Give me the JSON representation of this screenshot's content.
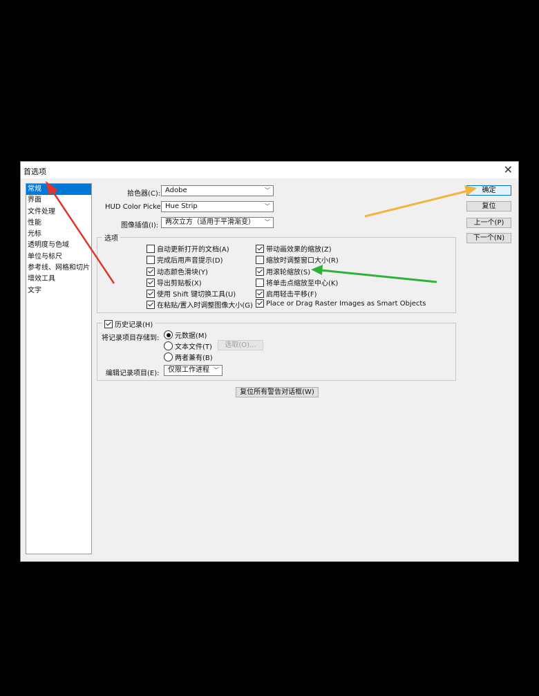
{
  "dialog": {
    "title": "首选项"
  },
  "sidebar": {
    "items": [
      {
        "label": "常规",
        "selected": true
      },
      {
        "label": "界面"
      },
      {
        "label": "文件处理"
      },
      {
        "label": "性能"
      },
      {
        "label": "光标"
      },
      {
        "label": "透明度与色域"
      },
      {
        "label": "单位与标尺"
      },
      {
        "label": "参考线、网格和切片"
      },
      {
        "label": "增效工具"
      },
      {
        "label": "文字"
      }
    ]
  },
  "fields": {
    "color_picker": {
      "label": "拾色器(C):",
      "value": "Adobe"
    },
    "hud_color_picker": {
      "label": "HUD Color Picker:",
      "value": "Hue Strip"
    },
    "image_interpolation": {
      "label": "图像插值(I):",
      "value": "两次立方（适用于平滑渐变）"
    }
  },
  "options": {
    "legend": "选项",
    "checkboxes": [
      {
        "label": "自动更新打开的文档(A)",
        "checked": false
      },
      {
        "label": "完成后用声音提示(D)",
        "checked": false
      },
      {
        "label": "动态颜色滑块(Y)",
        "checked": true
      },
      {
        "label": "导出剪贴板(X)",
        "checked": true
      },
      {
        "label": "使用 Shift 键切换工具(U)",
        "checked": true
      },
      {
        "label": "在粘贴/置入时调整图像大小(G)",
        "checked": true
      },
      {
        "label": "带动画效果的缩放(Z)",
        "checked": true
      },
      {
        "label": "缩放时调整窗口大小(R)",
        "checked": false
      },
      {
        "label": "用滚轮缩放(S)",
        "checked": true
      },
      {
        "label": "将单击点缩放至中心(K)",
        "checked": false
      },
      {
        "label": "启用轻击平移(F)",
        "checked": true
      },
      {
        "label": "Place or Drag Raster Images as Smart Objects",
        "checked": true
      }
    ]
  },
  "history": {
    "legend": "历史记录(H)",
    "enabled": true,
    "save_label": "将记录项目存储到:",
    "radios": [
      {
        "label": "元数据(M)",
        "selected": true
      },
      {
        "label": "文本文件(T)",
        "selected": false
      },
      {
        "label": "两者兼有(B)",
        "selected": false
      }
    ],
    "choose_button": "选取(O)...",
    "edit_label": "编辑记录项目(E):",
    "edit_value": "仅限工作进程"
  },
  "reset_warnings_button": "复位所有警告对话框(W)",
  "buttons": {
    "ok": "确定",
    "reset": "复位",
    "prev": "上一个(P)",
    "next": "下一个(N)"
  },
  "colors": {
    "selection": "#0078d7",
    "arrow_red": "#e0352b",
    "arrow_yellow": "#f2b43a",
    "arrow_green": "#2fb23a"
  }
}
